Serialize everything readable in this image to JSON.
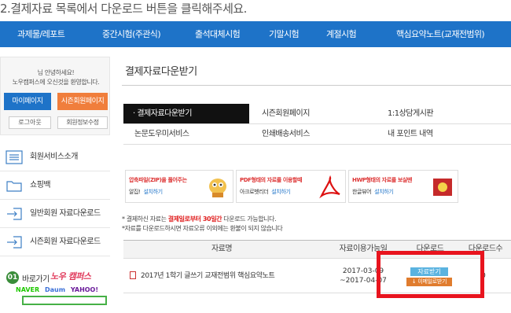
{
  "instruction": "2.결제자료 목록에서 다운로드 버튼을 클릭해주세요.",
  "topnav": [
    "과제물/레포트",
    "중간시험(주관식)",
    "출석대체시험",
    "기말시험",
    "계절시험",
    "핵심요약노트(교재전범위)"
  ],
  "sidebar": {
    "greeting_line1": "님 안녕하세요!",
    "greeting_line2": "노우캠퍼스에 오신것을 환영합니다.",
    "mypage_button": "마이페이지",
    "premium_button": "시즌회원페이지",
    "logout_button": "로그아웃",
    "edit_info_button": "회원정보수정",
    "menu": [
      {
        "label": "회원서비스소개",
        "icon": "list-icon"
      },
      {
        "label": "쇼핑백",
        "icon": "folder-icon"
      },
      {
        "label": "일반회원 자료다운로드",
        "icon": "arrow-in-icon"
      },
      {
        "label": "시즌회원 자료다운로드",
        "icon": "arrow-in-icon"
      }
    ],
    "shortcut": {
      "number": "01",
      "title": "바로가기",
      "brand": "노우 캠퍼스",
      "logos": [
        "NAVER",
        "Daum",
        "YAHOO!"
      ]
    }
  },
  "main": {
    "title": "결제자료다운받기",
    "tabs": [
      {
        "label": "결제자료다운받기",
        "active": true
      },
      {
        "label": "시즌회원페이지",
        "active": false
      },
      {
        "label": "1:1상담게시판",
        "active": false
      },
      {
        "label": "논문도우미서비스",
        "active": false
      },
      {
        "label": "인쇄배송서비스",
        "active": false
      },
      {
        "label": "내 포인트 내역",
        "active": false
      }
    ],
    "banners": [
      {
        "line1": "압축파일(ZIP)을 풀어주는",
        "line2": "알집!",
        "link": "설치하기"
      },
      {
        "line1": "PDF형태의 자료를 이용할때",
        "line2": "아크로벳리더",
        "link": "설치하기"
      },
      {
        "line1": "HWP형태의 자료를 보실땐",
        "line2": "한글뷰어",
        "link": "설치하기"
      }
    ],
    "notice": {
      "line1_pre": "* 결제하신 자료는 ",
      "line1_highlight": "결제일로부터 30일간",
      "line1_post": " 다운로드 가능합니다.",
      "line2": "*자료를 다운로드하시면 자료오류 이외에는 환불이 되지 않습니다"
    },
    "table": {
      "headers": [
        "자료명",
        "자료이용가능일",
        "다운로드",
        "다운로드수"
      ],
      "rows": [
        {
          "name": "2017년 1학기 글쓰기 교재전범위 핵심요약노트",
          "period_start": "2017-03-09",
          "period_end": "~2017-04-07",
          "download_button": "자료받기",
          "email_button": "이메일로받기",
          "count": "0"
        }
      ]
    }
  },
  "colors": {
    "nav_blue": "#1e73c8",
    "orange": "#f07e3c",
    "highlight_red": "#e8141e"
  }
}
